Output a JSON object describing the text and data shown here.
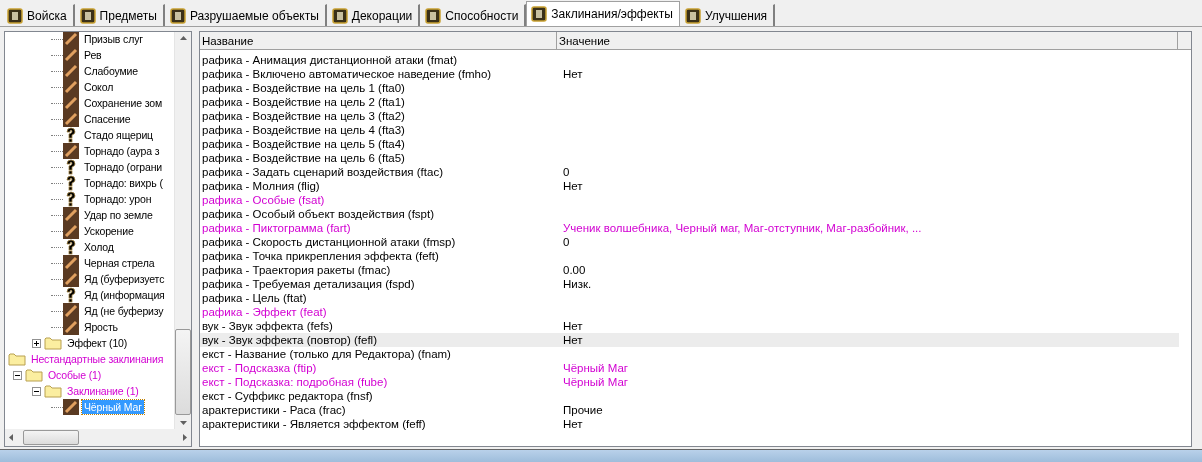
{
  "tabs": [
    {
      "label": "Войска",
      "selected": false
    },
    {
      "label": "Предметы",
      "selected": false
    },
    {
      "label": "Разрушаемые объекты",
      "selected": false
    },
    {
      "label": "Декорации",
      "selected": false
    },
    {
      "label": "Способности",
      "selected": false
    },
    {
      "label": "Заклинания/эффекты",
      "selected": true
    },
    {
      "label": "Улучшения",
      "selected": false
    }
  ],
  "tree": {
    "items": [
      {
        "kind": "hidden",
        "children": [
          {
            "kind": "hidden",
            "children": [
              {
                "kind": "hidden",
                "children": [
                  {
                    "kind": "picture",
                    "label": "Призыв слуг"
                  },
                  {
                    "kind": "picture",
                    "label": "Рев"
                  },
                  {
                    "kind": "picture",
                    "label": "Слабоумие"
                  },
                  {
                    "kind": "picture",
                    "label": "Сокол"
                  },
                  {
                    "kind": "picture",
                    "label": "Сохранение зом"
                  },
                  {
                    "kind": "picture",
                    "label": "Спасение"
                  },
                  {
                    "kind": "unknown",
                    "label": "Стадо ящериц"
                  },
                  {
                    "kind": "picture",
                    "label": "Торнадо (аура з"
                  },
                  {
                    "kind": "unknown",
                    "label": "Торнадо (ограни"
                  },
                  {
                    "kind": "unknown",
                    "label": "Торнадо: вихрь ("
                  },
                  {
                    "kind": "unknown",
                    "label": "Торнадо: урон"
                  },
                  {
                    "kind": "picture",
                    "label": "Удар по земле"
                  },
                  {
                    "kind": "picture",
                    "label": "Ускорение"
                  },
                  {
                    "kind": "unknown",
                    "label": "Холод"
                  },
                  {
                    "kind": "picture",
                    "label": "Черная стрела"
                  },
                  {
                    "kind": "picture",
                    "label": "Яд (буферизуетс"
                  },
                  {
                    "kind": "unknown",
                    "label": "Яд (информация"
                  },
                  {
                    "kind": "picture",
                    "label": "Яд (не буферизу"
                  },
                  {
                    "kind": "picture",
                    "label": "Ярость"
                  }
                ]
              },
              {
                "kind": "folder",
                "label": "Эффект (10)",
                "expanded": false,
                "custom": false
              }
            ]
          }
        ]
      },
      {
        "kind": "folder",
        "label": "Нестандартные заклинания",
        "custom": true,
        "children": [
          {
            "kind": "folder",
            "label": "Особые (1)",
            "expanded": true,
            "custom": true,
            "children": [
              {
                "kind": "folder",
                "label": "Заклинание (1)",
                "expanded": true,
                "custom": true,
                "children": [
                  {
                    "kind": "picture",
                    "label": "Чёрный Маг",
                    "selected": true
                  }
                ]
              }
            ]
          }
        ]
      }
    ]
  },
  "table": {
    "columns": [
      "Название",
      "Значение"
    ],
    "rows": [
      {
        "name": "рафика - Анимация дистанционной атаки (fmat)",
        "custom": false,
        "selected": false
      },
      {
        "name": "рафика - Включено автоматическое наведение (fmho)",
        "value": "Нет",
        "custom": false,
        "selected": false
      },
      {
        "name": "рафика - Воздействие на цель 1 (fta0)",
        "custom": false,
        "selected": false
      },
      {
        "name": "рафика - Воздействие на цель 2 (fta1)",
        "custom": false,
        "selected": false
      },
      {
        "name": "рафика - Воздействие на цель 3 (fta2)",
        "custom": false,
        "selected": false
      },
      {
        "name": "рафика - Воздействие на цель 4 (fta3)",
        "custom": false,
        "selected": false
      },
      {
        "name": "рафика - Воздействие на цель 5 (fta4)",
        "custom": false,
        "selected": false
      },
      {
        "name": "рафика - Воздействие на цель 6 (fta5)",
        "custom": false,
        "selected": false
      },
      {
        "name": "рафика - Задать сценарий воздействия (ftac)",
        "value": "0",
        "custom": false,
        "selected": false
      },
      {
        "name": "рафика - Молния (flig)",
        "value": "Нет",
        "custom": false,
        "selected": false
      },
      {
        "name": "рафика - Особые (fsat)",
        "custom": true,
        "selected": false
      },
      {
        "name": "рафика - Особый объект воздействия (fspt)",
        "custom": false,
        "selected": false
      },
      {
        "name": "рафика - Пиктограмма (fart)",
        "value": "Ученик волшебника, Черный маг, Маг-отступник, Маг-разбойник, ...",
        "custom": true,
        "selected": false
      },
      {
        "name": "рафика - Скорость дистанционной атаки (fmsp)",
        "value": "0",
        "custom": false,
        "selected": false
      },
      {
        "name": "рафика - Точка прикрепления эффекта (feft)",
        "custom": false,
        "selected": false
      },
      {
        "name": "рафика - Траектория ракеты (fmac)",
        "value": "0.00",
        "custom": false,
        "selected": false
      },
      {
        "name": "рафика - Требуемая детализация (fspd)",
        "value": "Низк.",
        "custom": false,
        "selected": false
      },
      {
        "name": "рафика - Цель (ftat)",
        "custom": false,
        "selected": false
      },
      {
        "name": "рафика - Эффект (feat)",
        "custom": true,
        "selected": false
      },
      {
        "name": "вук - Звук эффекта (fefs)",
        "value": "Нет",
        "custom": false,
        "selected": false
      },
      {
        "name": "вук - Звук эффекта (повтор) (fefl)",
        "value": "Нет",
        "custom": false,
        "selected": true
      },
      {
        "name": "екст - Название (только для Редактора) (fnam)",
        "custom": false,
        "selected": false
      },
      {
        "name": "екст - Подсказка (ftip)",
        "value": "Чёрный Маг",
        "custom": true,
        "selected": false
      },
      {
        "name": "екст - Подсказка: подробная (fube)",
        "value": "Чёрный Маг",
        "custom": true,
        "selected": false
      },
      {
        "name": "екст - Суффикс редактора (fnsf)",
        "custom": false,
        "selected": false
      },
      {
        "name": "арактеристики - Раса (frac)",
        "value": "Прочие",
        "custom": false,
        "selected": false
      },
      {
        "name": "арактеристики - Является эффектом (feff)",
        "value": "Нет",
        "custom": false,
        "selected": false
      }
    ]
  }
}
